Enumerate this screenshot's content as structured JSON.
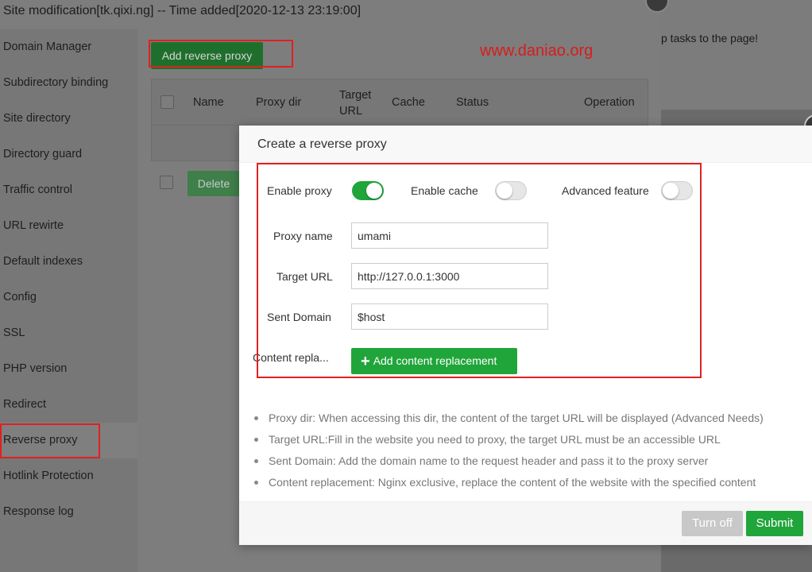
{
  "background": {
    "notice_text": "p tasks to the page!"
  },
  "site_window": {
    "title": "Site modification[tk.qixi.ng] -- Time added[2020-12-13 23:19:00]",
    "sidebar": [
      {
        "label": "Domain Manager"
      },
      {
        "label": "Subdirectory binding"
      },
      {
        "label": "Site directory"
      },
      {
        "label": "Directory guard"
      },
      {
        "label": "Traffic control"
      },
      {
        "label": "URL rewirte"
      },
      {
        "label": "Default indexes"
      },
      {
        "label": "Config"
      },
      {
        "label": "SSL"
      },
      {
        "label": "PHP version"
      },
      {
        "label": "Redirect"
      },
      {
        "label": "Reverse proxy"
      },
      {
        "label": "Hotlink Protection"
      },
      {
        "label": "Response log"
      }
    ],
    "active_item": "Reverse proxy",
    "add_button": "Add reverse proxy",
    "watermark": "www.daniao.org",
    "table": {
      "headers": [
        "Name",
        "Proxy dir",
        "Target URL",
        "Cache",
        "Status",
        "Operation"
      ]
    },
    "delete_button": "Delete"
  },
  "modal": {
    "title": "Create a reverse proxy",
    "toggles": [
      {
        "label": "Enable proxy",
        "on": true
      },
      {
        "label": "Enable cache",
        "on": false
      },
      {
        "label": "Advanced feature",
        "on": false
      }
    ],
    "fields": {
      "proxy_name": {
        "label": "Proxy name",
        "value": "umami"
      },
      "target_url": {
        "label": "Target URL",
        "value": "http://127.0.0.1:3000"
      },
      "sent_domain": {
        "label": "Sent Domain",
        "value": "$host"
      }
    },
    "content_replace_label": "Content repla...",
    "add_content_button": "Add content replacement",
    "tips": [
      "Proxy dir: When accessing this dir, the content of the target URL will be displayed (Advanced Needs)",
      "Target URL:Fill in the website you need to proxy, the target URL must be an accessible URL",
      "Sent Domain: Add the domain name to the request header and pass it to the proxy server",
      "Content replacement: Nginx exclusive, replace the content of the website with the specified content"
    ],
    "buttons": {
      "turn_off": "Turn off",
      "submit": "Submit"
    }
  },
  "colors": {
    "accent": "#20a53a",
    "highlight_box": "#e02020"
  }
}
